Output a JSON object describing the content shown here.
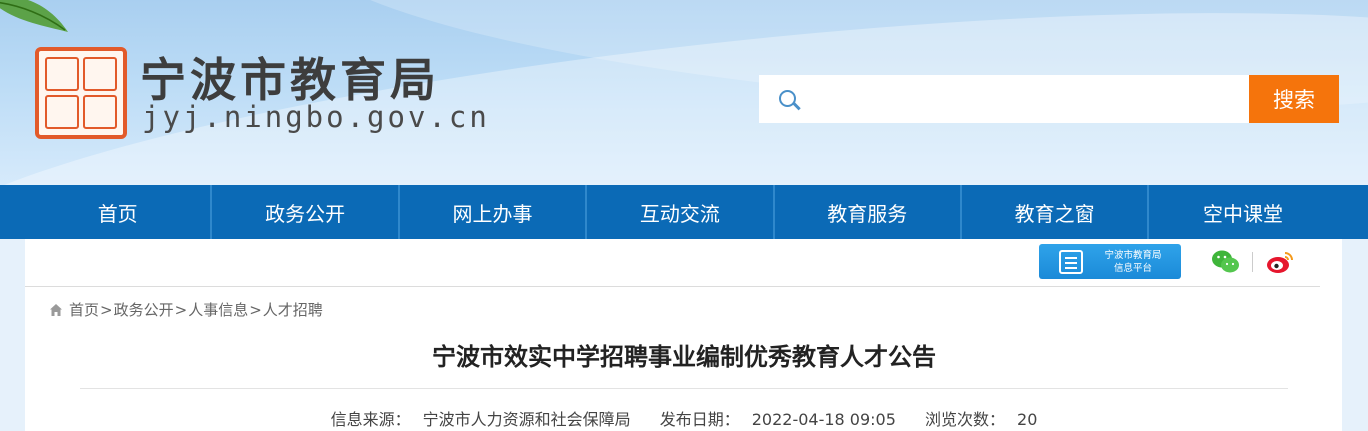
{
  "header": {
    "site_title": "宁波市教育局",
    "site_url": "jyj.ningbo.gov.cn",
    "search": {
      "placeholder": "",
      "button_label": "搜索"
    }
  },
  "nav": {
    "items": [
      "首页",
      "政务公开",
      "网上办事",
      "互动交流",
      "教育服务",
      "教育之窗",
      "空中课堂"
    ]
  },
  "tools": {
    "platform_label_line1": "宁波市教育局",
    "platform_label_line2": "信息平台",
    "wechat_icon": "wechat-icon",
    "weibo_icon": "weibo-icon"
  },
  "breadcrumb": [
    "首页",
    "政务公开",
    "人事信息",
    "人才招聘"
  ],
  "article": {
    "title": "宁波市效实中学招聘事业编制优秀教育人才公告",
    "source_label": "信息来源：",
    "source_value": "宁波市人力资源和社会保障局",
    "date_label": "发布日期：",
    "date_value": "2022-04-18 09:05",
    "views_label": "浏览次数：",
    "views_value": "20"
  },
  "colors": {
    "nav_bg": "#0b6ab6",
    "search_button": "#f5740c",
    "seal": "#e25a2a"
  }
}
